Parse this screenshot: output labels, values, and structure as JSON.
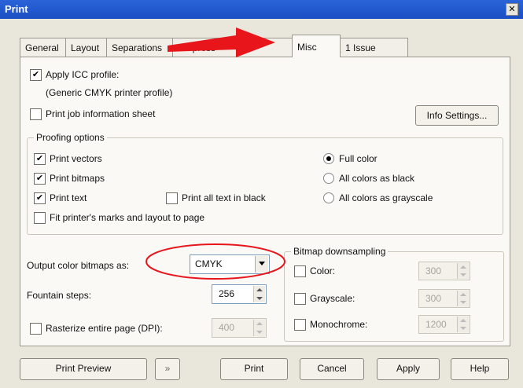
{
  "window": {
    "title": "Print",
    "close_glyph": "✕"
  },
  "tabs": [
    {
      "label": "General"
    },
    {
      "label": "Layout"
    },
    {
      "label": "Separations"
    },
    {
      "label": "Prepress"
    },
    {
      "label": "Misc"
    },
    {
      "label": "1 Issue",
      "icon": "warning-icon"
    }
  ],
  "misc": {
    "apply_icc_label": "Apply ICC profile:",
    "apply_icc_checked": true,
    "icc_profile_value": "(Generic CMYK printer profile)",
    "print_job_info_label": "Print job information sheet",
    "info_settings_button": "Info Settings...",
    "proofing": {
      "title": "Proofing options",
      "print_vectors": "Print vectors",
      "print_bitmaps": "Print bitmaps",
      "print_text": "Print text",
      "print_all_text_black": "Print all text in black",
      "fit_marks": "Fit printer's marks and layout to page",
      "full_color": "Full color",
      "all_colors_black": "All colors as black",
      "all_colors_grayscale": "All colors as grayscale"
    },
    "output_color_label": "Output color bitmaps as:",
    "output_color_value": "CMYK",
    "fountain_steps_label": "Fountain steps:",
    "fountain_steps_value": "256",
    "rasterize_label": "Rasterize entire page (DPI):",
    "rasterize_value": "400",
    "downsampling": {
      "title": "Bitmap downsampling",
      "color_label": "Color:",
      "color_value": "300",
      "grayscale_label": "Grayscale:",
      "grayscale_value": "300",
      "mono_label": "Monochrome:",
      "mono_value": "1200"
    }
  },
  "buttons": {
    "print_preview": "Print Preview",
    "print": "Print",
    "cancel": "Cancel",
    "apply": "Apply",
    "help": "Help"
  },
  "annotations": {
    "arrow_color": "#e8151b",
    "ellipse_color": "#e8151b"
  }
}
